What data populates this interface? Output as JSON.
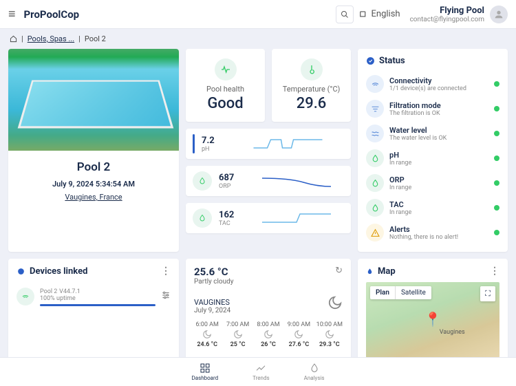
{
  "brand": "ProPoolCop",
  "lang": "English",
  "user": {
    "name": "Flying Pool",
    "email": "contact@flyingpool.com"
  },
  "crumbs": {
    "root": "Pools, Spas ...",
    "current": "Pool 2"
  },
  "pool": {
    "name": "Pool 2",
    "datetime": "July 9, 2024 5:34:54 AM",
    "location": "Vaugines, France"
  },
  "health": {
    "label": "Pool health",
    "value": "Good"
  },
  "temp": {
    "label": "Temperature (°C)",
    "value": "29.6"
  },
  "metrics": [
    {
      "value": "7.2",
      "label": "pH"
    },
    {
      "value": "687",
      "label": "ORP"
    },
    {
      "value": "162",
      "label": "TAC"
    }
  ],
  "status": {
    "title": "Status",
    "items": [
      {
        "title": "Connectivity",
        "sub": "1/1 device(s) are connected",
        "icon": "wifi"
      },
      {
        "title": "Filtration mode",
        "sub": "The filtration is OK",
        "icon": "filter"
      },
      {
        "title": "Water level",
        "sub": "The water level is OK",
        "icon": "level"
      },
      {
        "title": "pH",
        "sub": "In range",
        "icon": "drop"
      },
      {
        "title": "ORP",
        "sub": "In range",
        "icon": "drop"
      },
      {
        "title": "TAC",
        "sub": "In range",
        "icon": "drop"
      },
      {
        "title": "Alerts",
        "sub": "Nothing, there is no alert!",
        "icon": "warn"
      }
    ]
  },
  "devices": {
    "title": "Devices linked",
    "items": [
      {
        "name": "Pool 2",
        "version": "V44.7.1",
        "uptime": "100% uptime"
      }
    ]
  },
  "weather": {
    "temp": "25.6 °C",
    "cond": "Partly cloudy",
    "loc": "VAUGINES",
    "date": "July 9, 2024",
    "hours": [
      {
        "t": "6:00 AM",
        "v": "24.6 °C"
      },
      {
        "t": "7:00 AM",
        "v": "25 °C"
      },
      {
        "t": "8:00 AM",
        "v": "26 °C"
      },
      {
        "t": "9:00 AM",
        "v": "27.6 °C"
      },
      {
        "t": "10:00 AM",
        "v": "29.3 °C"
      }
    ]
  },
  "map": {
    "title": "Map",
    "plan": "Plan",
    "sat": "Satellite",
    "loc": "Vaugines"
  },
  "nav": {
    "dashboard": "Dashboard",
    "trends": "Trends",
    "analysis": "Analysis"
  }
}
